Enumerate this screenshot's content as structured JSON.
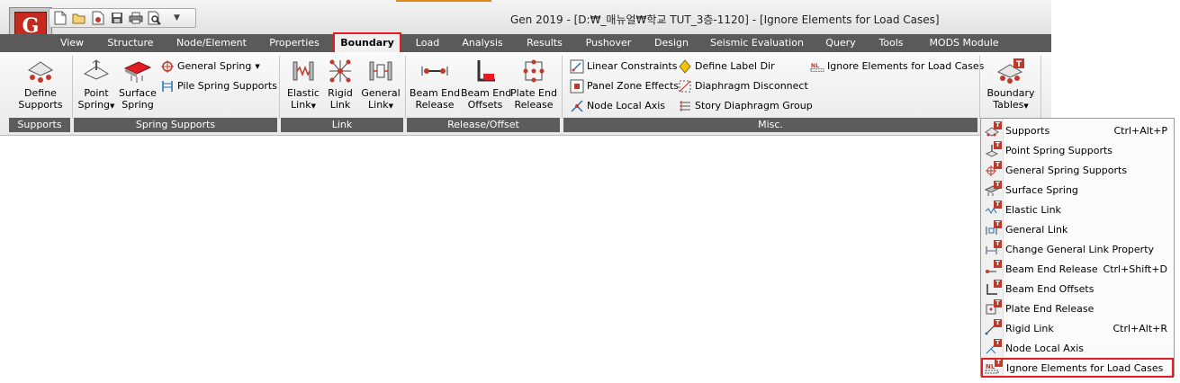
{
  "window": {
    "title": "Gen 2019 - [D:₩_매뉴얼₩학교 TUT_3층-1120] - [Ignore Elements for Load Cases]",
    "logo_text": "G",
    "quick_access": [
      "new-file-icon",
      "open-folder-icon",
      "save-as-icon",
      "save-icon",
      "print-icon",
      "print-preview-icon"
    ],
    "quick_access_dropdown": "▼"
  },
  "tabs": [
    {
      "label": "View"
    },
    {
      "label": "Structure"
    },
    {
      "label": "Node/Element"
    },
    {
      "label": "Properties"
    },
    {
      "label": "Boundary",
      "active": true
    },
    {
      "label": "Load"
    },
    {
      "label": "Analysis"
    },
    {
      "label": "Results"
    },
    {
      "label": "Pushover"
    },
    {
      "label": "Design"
    },
    {
      "label": "Seismic Evaluation"
    },
    {
      "label": "Query"
    },
    {
      "label": "Tools"
    },
    {
      "label": "MODS Module"
    }
  ],
  "ribbon": {
    "groups": {
      "supports": "Supports",
      "spring_supports": "Spring Supports",
      "link": "Link",
      "release_offset": "Release/Offset",
      "misc": "Misc."
    },
    "buttons": {
      "define_supports": {
        "line1": "Define",
        "line2": "Supports"
      },
      "point_spring": {
        "line1": "Point",
        "line2": "Spring"
      },
      "surface_spring": {
        "line1": "Surface",
        "line2": "Spring"
      },
      "general_spring": "General Spring",
      "pile_spring": "Pile Spring Supports",
      "elastic_link": {
        "line1": "Elastic",
        "line2": "Link"
      },
      "rigid_link": {
        "line1": "Rigid",
        "line2": "Link"
      },
      "general_link": {
        "line1": "General",
        "line2": "Link"
      },
      "beam_end_release": {
        "line1": "Beam End",
        "line2": "Release"
      },
      "beam_end_offsets": {
        "line1": "Beam End",
        "line2": "Offsets"
      },
      "plate_end_release": {
        "line1": "Plate End",
        "line2": "Release"
      },
      "linear_constraints": "Linear Constraints",
      "panel_zone_effects": "Panel Zone Effects",
      "node_local_axis": "Node Local Axis",
      "define_label_dir": "Define Label Dir",
      "diaphragm_disconnect": "Diaphragm Disconnect",
      "story_diaphragm_group": "Story Diaphragm Group",
      "ignore_elements": "Ignore Elements for Load Cases",
      "boundary_tables": {
        "line1": "Boundary",
        "line2": "Tables"
      }
    }
  },
  "menu": {
    "items": [
      {
        "label": "Supports",
        "shortcut": "Ctrl+Alt+P"
      },
      {
        "label": "Point Spring Supports",
        "shortcut": ""
      },
      {
        "label": "General Spring Supports",
        "shortcut": ""
      },
      {
        "label": "Surface Spring",
        "shortcut": ""
      },
      {
        "label": "Elastic Link",
        "shortcut": ""
      },
      {
        "label": "General Link",
        "shortcut": ""
      },
      {
        "label": "Change General Link Property",
        "shortcut": ""
      },
      {
        "label": "Beam End Release",
        "shortcut": "Ctrl+Shift+D"
      },
      {
        "label": "Beam End Offsets",
        "shortcut": ""
      },
      {
        "label": "Plate End Release",
        "shortcut": ""
      },
      {
        "label": "Rigid Link",
        "shortcut": "Ctrl+Alt+R"
      },
      {
        "label": "Node Local Axis",
        "shortcut": ""
      },
      {
        "label": "Ignore Elements for Load Cases",
        "shortcut": ""
      }
    ]
  },
  "colors": {
    "accent_red": "#e31b23",
    "tab_bar": "#5a5a5a",
    "group_label": "#5c5c5c"
  }
}
